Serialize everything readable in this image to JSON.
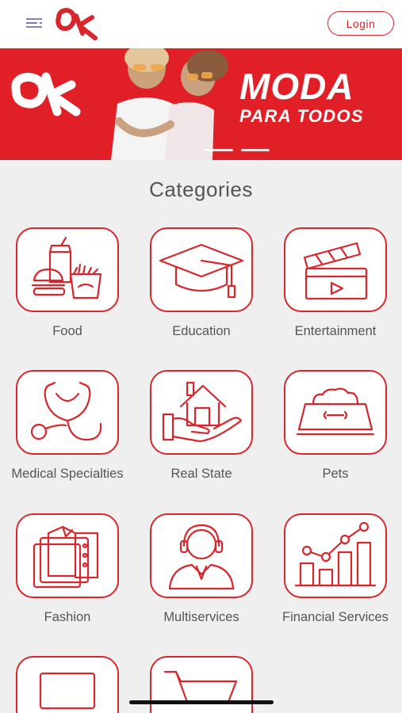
{
  "header": {
    "login_label": "Login",
    "brand_color": "#d8262c"
  },
  "banner": {
    "title": "MODA",
    "subtitle": "PARA TODOS",
    "slides_visible": 2,
    "background": "#e01f26"
  },
  "categories": {
    "title": "Categories",
    "items": [
      {
        "label": "Food",
        "icon": "food-icon"
      },
      {
        "label": "Education",
        "icon": "graduation-cap-icon"
      },
      {
        "label": "Entertainment",
        "icon": "clapperboard-icon"
      },
      {
        "label": "Medical Specialties",
        "icon": "stethoscope-icon"
      },
      {
        "label": "Real State",
        "icon": "house-in-hand-icon"
      },
      {
        "label": "Pets",
        "icon": "pet-bowl-icon"
      },
      {
        "label": "Fashion",
        "icon": "shirt-icon"
      },
      {
        "label": "Multiservices",
        "icon": "headset-agent-icon"
      },
      {
        "label": "Financial Services",
        "icon": "chart-icon"
      },
      {
        "label": "",
        "icon": "laptop-icon"
      },
      {
        "label": "",
        "icon": "shopping-cart-icon"
      }
    ]
  }
}
